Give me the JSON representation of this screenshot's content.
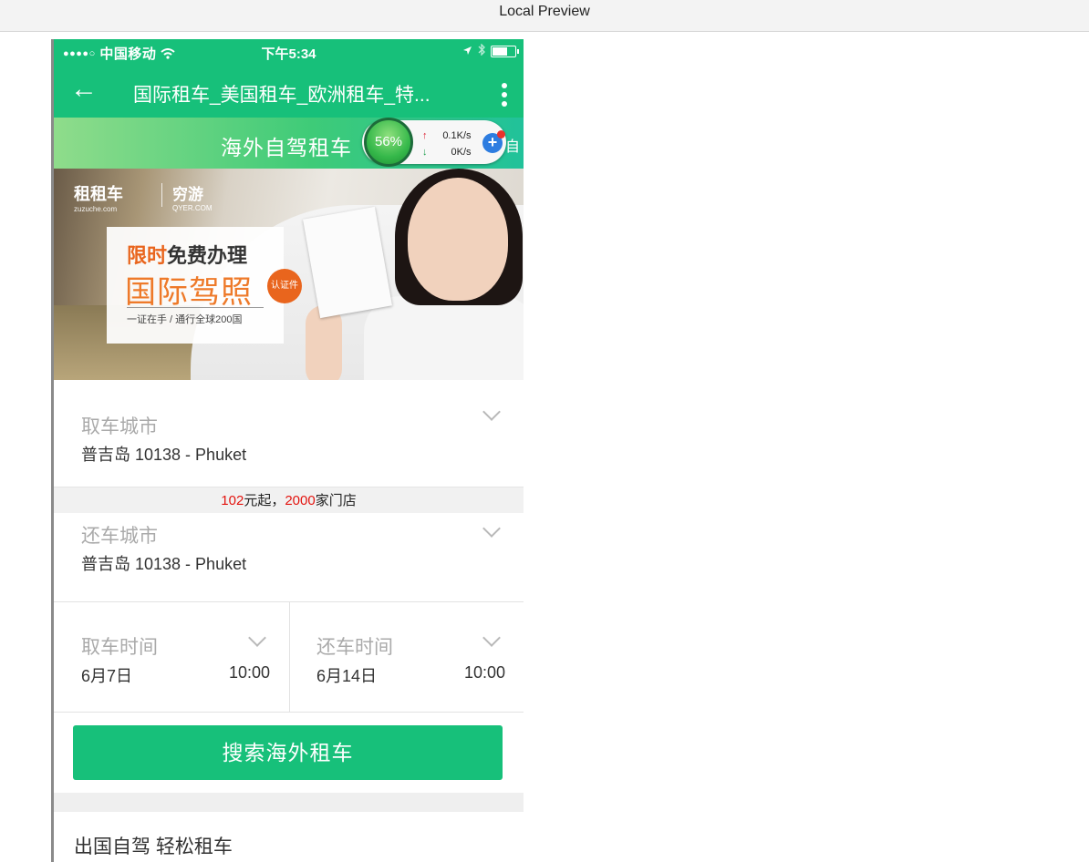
{
  "preview_bar": {
    "title": "Local Preview"
  },
  "status_bar": {
    "carrier": "中国移动",
    "time": "下午5:34"
  },
  "nav": {
    "back_icon": "←",
    "title": "国际租车_美国租车_欧洲租车_特..."
  },
  "subheader": {
    "title": "海外自驾租车",
    "truncated_text": "自"
  },
  "speed_widget": {
    "percent": "56%",
    "upload_rate": "0.1K/s",
    "download_rate": "0K/s",
    "up_arrow": "↑",
    "down_arrow": "↓",
    "plus": "+"
  },
  "banner": {
    "logo_zuzuche": "租租车",
    "logo_zuzuche_url": "zuzuche.com",
    "logo_qyer": "穷游",
    "logo_qyer_url": "QYER.COM",
    "promo_line1_highlight": "限时",
    "promo_line1_rest": "免费办理",
    "promo_line2": "国际驾照",
    "promo_line3": "一证在手 / 通行全球200国",
    "promo_badge": "认证件"
  },
  "pickup_city": {
    "label": "取车城市",
    "value": "普吉岛 10138 - Phuket"
  },
  "notice": {
    "price": "102",
    "price_text": "元起，",
    "stores": "2000",
    "stores_text": "家门店"
  },
  "return_city": {
    "label": "还车城市",
    "value": "普吉岛 10138 - Phuket"
  },
  "pickup_time": {
    "label": "取车时间",
    "date": "6月7日",
    "time": "10:00"
  },
  "return_time": {
    "label": "还车时间",
    "date": "6月14日",
    "time": "10:00"
  },
  "search_button": {
    "label": "搜索海外租车"
  },
  "section": {
    "title": "出国自驾 轻松租车"
  },
  "colors": {
    "brand_green": "#17c07a",
    "notice_red": "#e3140f",
    "promo_orange": "#ee7a2a"
  }
}
